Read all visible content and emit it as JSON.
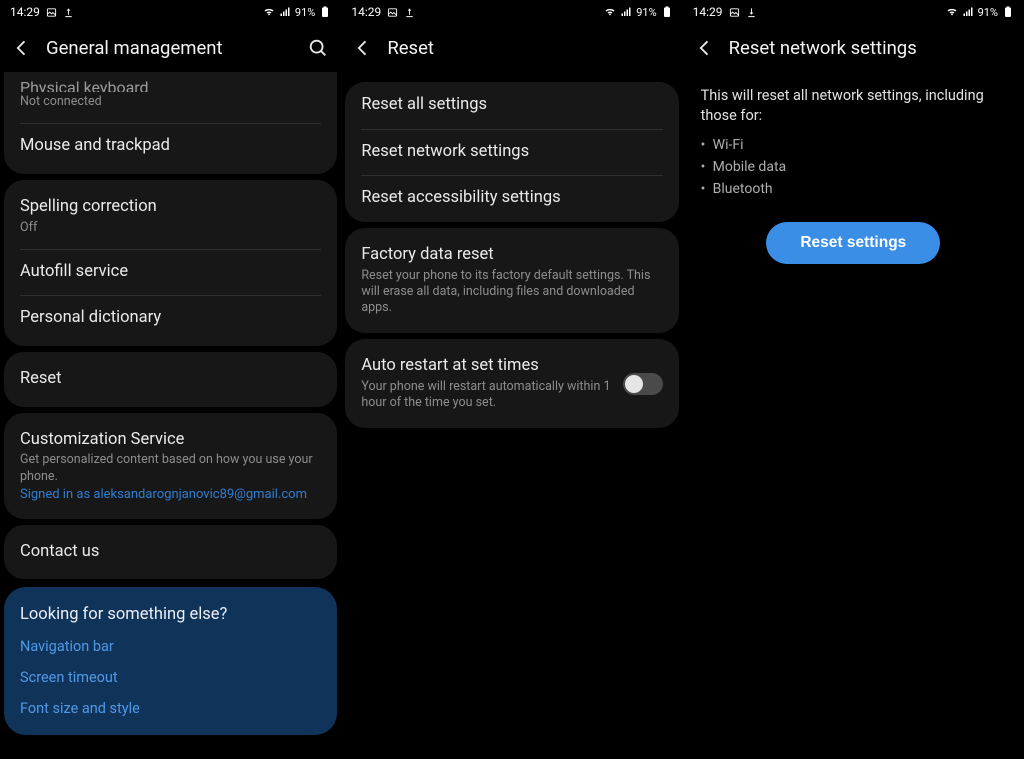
{
  "status": {
    "time": "14:29",
    "battery": "91%"
  },
  "screen1": {
    "title": "General management",
    "group_top": {
      "physical_keyboard": {
        "title": "Physical keyboard",
        "sub": "Not connected"
      },
      "mouse_trackpad": {
        "title": "Mouse and trackpad"
      }
    },
    "group_text": {
      "spelling": {
        "title": "Spelling correction",
        "sub": "Off"
      },
      "autofill": {
        "title": "Autofill service"
      },
      "dictionary": {
        "title": "Personal dictionary"
      }
    },
    "group_reset": {
      "reset": {
        "title": "Reset"
      }
    },
    "group_custom": {
      "customization": {
        "title": "Customization Service",
        "sub": "Get personalized content based on how you use your phone.",
        "signed_in": "Signed in as aleksandarognjanovic89@gmail.com"
      }
    },
    "group_contact": {
      "contact": {
        "title": "Contact us"
      }
    },
    "lfse": {
      "heading": "Looking for something else?",
      "links": {
        "nav": "Navigation bar",
        "timeout": "Screen timeout",
        "font": "Font size and style"
      }
    }
  },
  "screen2": {
    "title": "Reset",
    "options": {
      "all": "Reset all settings",
      "network": "Reset network settings",
      "accessibility": "Reset accessibility settings"
    },
    "factory": {
      "title": "Factory data reset",
      "sub": "Reset your phone to its factory default settings. This will erase all data, including files and downloaded apps."
    },
    "autorestart": {
      "title": "Auto restart at set times",
      "sub": "Your phone will restart automatically within 1 hour of the time you set."
    }
  },
  "screen3": {
    "title": "Reset network settings",
    "intro": "This will reset all network settings, including those for:",
    "bullets": {
      "wifi": "Wi-Fi",
      "mobile": "Mobile data",
      "bt": "Bluetooth"
    },
    "button": "Reset settings"
  }
}
